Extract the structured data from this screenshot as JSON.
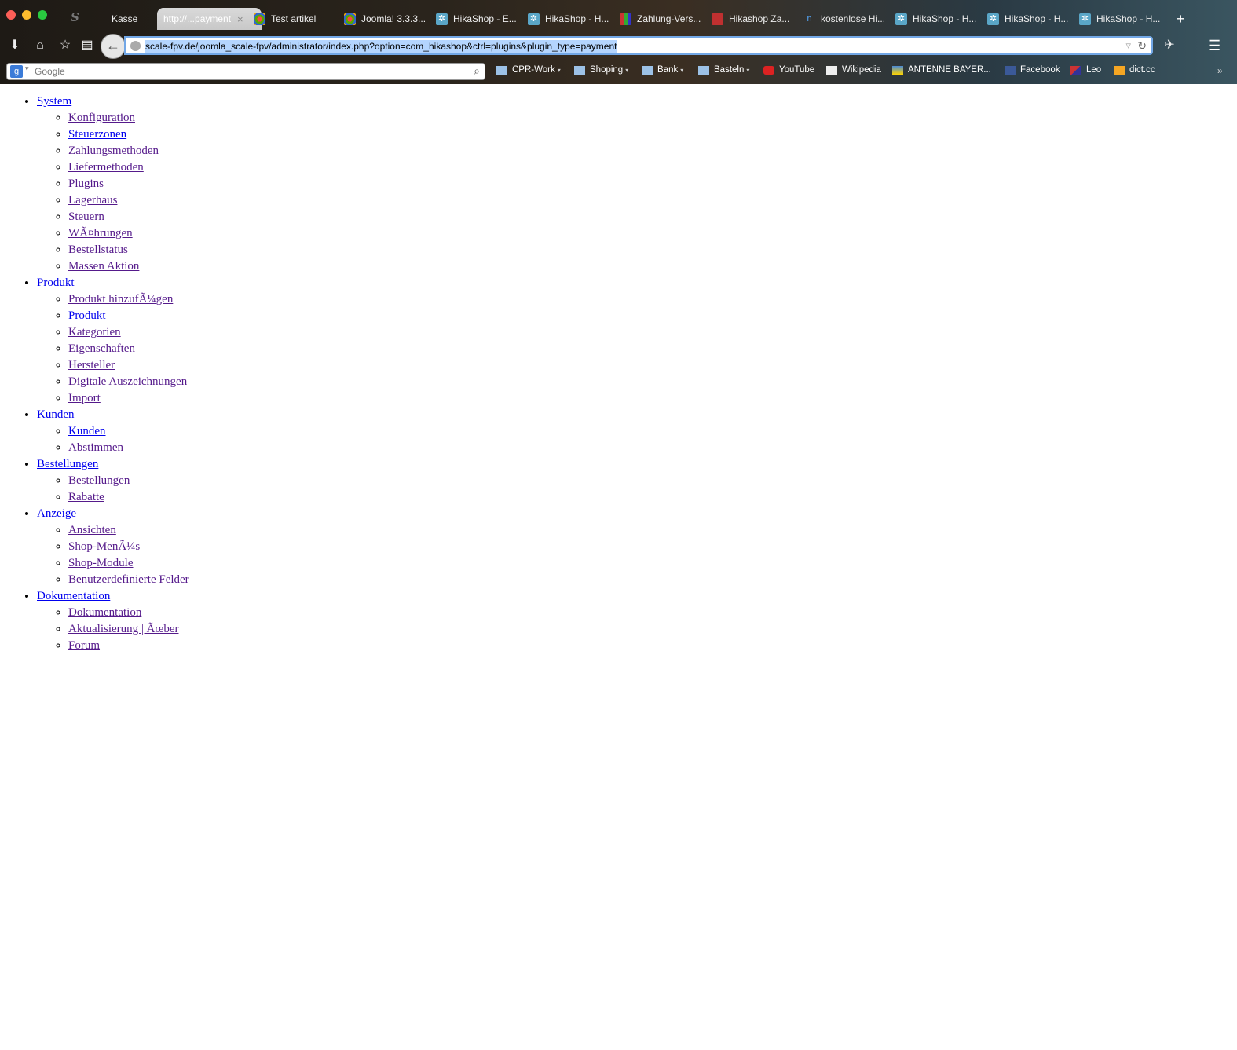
{
  "browser": {
    "tabs": [
      {
        "label": "Kasse",
        "icon": "default-icon"
      },
      {
        "label": "http://...payment",
        "icon": "none",
        "active": true
      },
      {
        "label": "Test artikel",
        "icon": "joomla-icon"
      },
      {
        "label": "Joomla! 3.3.3...",
        "icon": "joomla-icon"
      },
      {
        "label": "HikaShop - E...",
        "icon": "hikashop-icon"
      },
      {
        "label": "HikaShop - H...",
        "icon": "hikashop-icon"
      },
      {
        "label": "Zahlung-Vers...",
        "icon": "colorbars-icon"
      },
      {
        "label": "Hikashop Za...",
        "icon": "hikashop-red-icon"
      },
      {
        "label": "kostenlose Hi...",
        "icon": "n-icon"
      },
      {
        "label": "HikaShop - H...",
        "icon": "hikashop-icon"
      },
      {
        "label": "HikaShop - H...",
        "icon": "hikashop-icon"
      },
      {
        "label": "HikaShop - H...",
        "icon": "hikashop-icon"
      }
    ],
    "new_tab": "+",
    "url": "scale-fpv.de/joomla_scale-fpv/administrator/index.php?option=com_hikashop&ctrl=plugins&plugin_type=payment",
    "search_placeholder": "Google",
    "search_engine_letter": "g",
    "bookmarks": [
      {
        "label": "CPR-Work",
        "icon": "folder-icon",
        "folder": true
      },
      {
        "label": "Shoping",
        "icon": "folder-icon",
        "folder": true
      },
      {
        "label": "Bank",
        "icon": "folder-icon",
        "folder": true
      },
      {
        "label": "Basteln",
        "icon": "folder-icon",
        "folder": true
      },
      {
        "label": "YouTube",
        "icon": "youtube-icon"
      },
      {
        "label": "Wikipedia",
        "icon": "wikipedia-icon"
      },
      {
        "label": "ANTENNE BAYER...",
        "icon": "antenne-icon"
      },
      {
        "label": "Facebook",
        "icon": "facebook-icon"
      },
      {
        "label": "Leo",
        "icon": "leo-icon"
      },
      {
        "label": "dict.cc",
        "icon": "dictcc-icon"
      }
    ],
    "bookmarks_more": "»"
  },
  "menu": [
    {
      "label": "System",
      "items": [
        "Konfiguration",
        "Steuerzonen",
        "Zahlungsmethoden",
        "Liefermethoden",
        "Plugins",
        "Lagerhaus",
        "Steuern",
        "WÃ¤hrungen",
        "Bestellstatus",
        "Massen Aktion"
      ]
    },
    {
      "label": "Produkt",
      "items": [
        "Produkt hinzufÃ¼gen",
        "Produkt",
        "Kategorien",
        "Eigenschaften",
        "Hersteller",
        "Digitale Auszeichnungen",
        "Import"
      ]
    },
    {
      "label": "Kunden",
      "items": [
        "Kunden",
        "Abstimmen"
      ]
    },
    {
      "label": "Bestellungen",
      "items": [
        "Bestellungen",
        "Rabatte"
      ]
    },
    {
      "label": "Anzeige",
      "items": [
        "Ansichten",
        "Shop-MenÃ¼s",
        "Shop-Module",
        "Benutzerdefinierte Felder"
      ]
    },
    {
      "label": "Dokumentation",
      "items": [
        "Dokumentation",
        "Aktualisierung | Ãœber",
        "Forum"
      ]
    }
  ],
  "colors": {
    "link": "#0000ee",
    "visited_link": "#551a8b",
    "url_highlight": "#b4d5fe"
  }
}
